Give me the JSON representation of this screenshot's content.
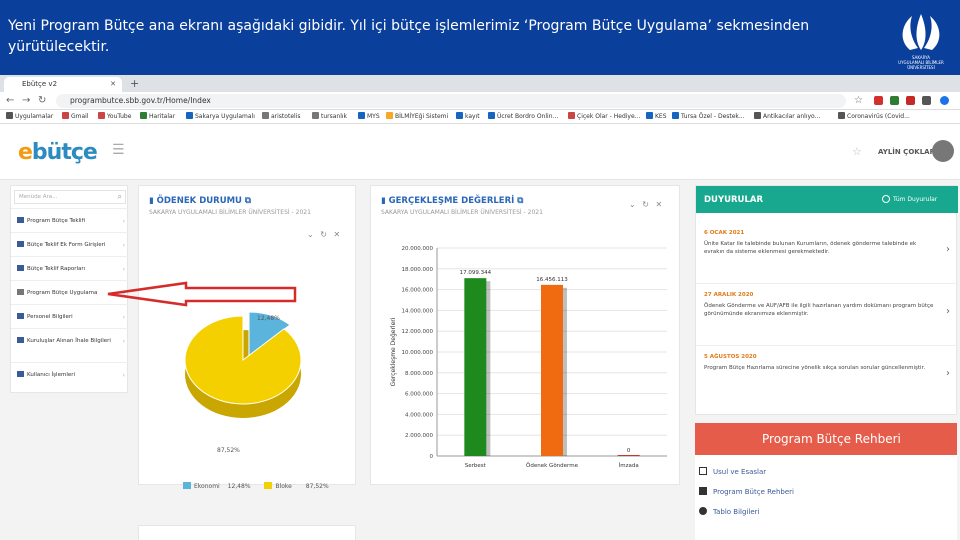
{
  "slide": {
    "text": "Yeni Program Bütçe ana ekranı aşağıdaki gibidir. Yıl içi bütçe işlemlerimiz ‘Program Bütçe Uygulama’ sekmesinden yürütülecektir.",
    "logo_lines": [
      "SAKARYA",
      "UYGULAMALI BİLİMLER",
      "ÜNİVERSİTESİ"
    ]
  },
  "browser": {
    "tab_title": "Ebütçe v2",
    "url": "programbutce.sbb.gov.tr/Home/Index",
    "bookmarks": [
      "Uygulamalar",
      "Gmail",
      "YouTube",
      "Haritalar",
      "Sakarya Uygulamalı",
      "aristotelis",
      "tursanlık",
      "MYS",
      "BİLMİYEği Sistemi",
      "kayıt",
      "Ücret Bordro Onlin...",
      "Çiçek Olar - Hediye...",
      "KES",
      "Tursa Özel - Destek...",
      "Antikacılar anlıyo...",
      "Coronavirüs (Covid..."
    ]
  },
  "app": {
    "brand_e": "e",
    "brand_rest": "bütçe",
    "user": "AYLİN ÇOKLAR"
  },
  "menu": {
    "search_placeholder": "Menüde Ara...",
    "items": [
      "Program Bütçe Teklifi",
      "Bütçe Teklif Ek Form Girişleri",
      "Bütçe Teklif Raporları",
      "Program Bütçe Uygulama",
      "Personel Bilgileri",
      "Kuruluşlar Alınan İhale Bilgileri",
      "Kullanıcı İşlemleri"
    ]
  },
  "odenek": {
    "title": "ÖDENEK DURUMU",
    "subtitle": "SAKARYA UYGULAMALI BİLİMLER ÜNİVERSİTESİ - 2021",
    "slice_labels": [
      "12,48%",
      "87,52%"
    ],
    "legend": [
      {
        "name": "Ekonomi",
        "value": "12,48%"
      },
      {
        "name": "Bloke",
        "value": "87,52%"
      }
    ]
  },
  "gerceklesme": {
    "title": "GERÇEKLEŞME DEĞERLERİ",
    "subtitle": "SAKARYA UYGULAMALI BİLİMLER ÜNİVERSİTESİ - 2021",
    "ylabel": "Gerçekleşme Değerleri"
  },
  "chart_data": {
    "type": "bar",
    "title": "GERÇEKLEŞME DEĞERLERİ",
    "ylabel": "Gerçekleşme Değerleri",
    "categories": [
      "Serbest",
      "Ödenek Gönderme",
      "İmzada"
    ],
    "values": [
      17099344,
      16456113,
      0
    ],
    "data_labels": [
      "17.099.344",
      "16.456.113",
      "0"
    ],
    "ylim": [
      0,
      20000000
    ],
    "yticks": [
      "0",
      "2.000.000",
      "4.000.000",
      "6.000.000",
      "8.000.000",
      "10.000.000",
      "12.000.000",
      "14.000.000",
      "16.000.000",
      "18.000.000",
      "20.000.000"
    ],
    "colors": [
      "#1e8a1e",
      "#f06a10",
      "#c0392b"
    ],
    "grid": true
  },
  "pie_data": {
    "type": "pie",
    "labels": [
      "Ekonomi",
      "Bloke"
    ],
    "values": [
      12.48,
      87.52
    ],
    "colors": [
      "#5ab4dc",
      "#f4d000"
    ]
  },
  "announcements": {
    "title": "DUYURULAR",
    "all": "Tüm Duyurular",
    "items": [
      {
        "date": "6 OCAK 2021",
        "text": "Ünite Katar ile talebinde bulunan Kurumların, ödenek gönderme talebinde ek evrakın da sisteme eklenmesi gerekmektedir."
      },
      {
        "date": "27 ARALIK 2020",
        "text": "Ödenek Gönderme ve AUF/AFB ile ilgili hazırlanan yardım dokümanı program bütçe görünümünde ekranımıza eklenmiştir."
      },
      {
        "date": "5 AĞUSTOS 2020",
        "text": "Program Bütçe Hazırlama sürecine yönelik sıkça sorulan sorular güncellenmiştir."
      }
    ]
  },
  "guide": {
    "title": "Program Bütçe Rehberi",
    "items": [
      "Usul ve Esaslar",
      "Program Bütçe Rehberi",
      "Tablo Bilgileri"
    ]
  },
  "colors": {
    "slide_header": "#0b3f9c",
    "teal": "#18a88f",
    "guide_red": "#e55c4a",
    "arrow": "#d62b2b"
  }
}
